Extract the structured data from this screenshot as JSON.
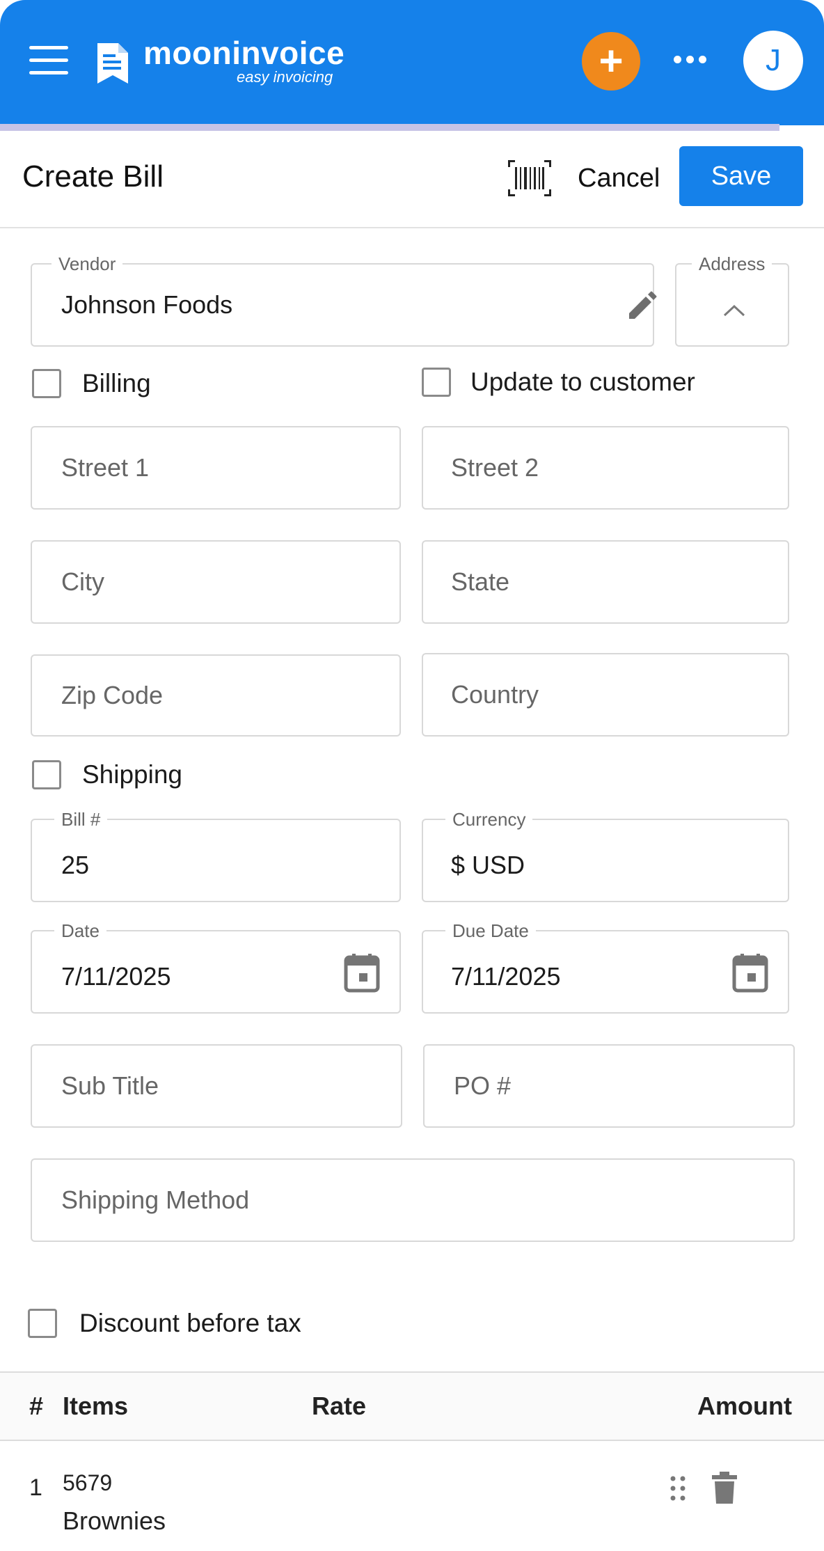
{
  "app": {
    "brand_name": "mooninvoice",
    "brand_tagline": "easy invoicing",
    "add_label": "+",
    "avatar_initial": "J",
    "colors": {
      "primary": "#1581ea",
      "accent": "#f0891c"
    }
  },
  "header": {
    "title": "Create Bill",
    "cancel_label": "Cancel",
    "save_label": "Save"
  },
  "form": {
    "vendor": {
      "label": "Vendor",
      "value": "Johnson Foods"
    },
    "address": {
      "label": "Address"
    },
    "billing_label": "Billing",
    "update_customer_label": "Update to customer",
    "street1_placeholder": "Street 1",
    "street2_placeholder": "Street 2",
    "city_placeholder": "City",
    "state_placeholder": "State",
    "zip_placeholder": "Zip Code",
    "country_placeholder": "Country",
    "shipping_label": "Shipping",
    "bill_no": {
      "label": "Bill #",
      "value": "25"
    },
    "currency": {
      "label": "Currency",
      "value": "$ USD"
    },
    "date": {
      "label": "Date",
      "value": "7/11/2025"
    },
    "due_date": {
      "label": "Due Date",
      "value": "7/11/2025"
    },
    "subtitle_placeholder": "Sub Title",
    "po_placeholder": "PO #",
    "shipping_method_placeholder": "Shipping Method",
    "discount_before_tax_label": "Discount before tax"
  },
  "items_table": {
    "columns": {
      "num": "#",
      "items": "Items",
      "rate": "Rate",
      "amount": "Amount"
    },
    "rows": [
      {
        "num": "1",
        "code": "5679",
        "name": "Brownies"
      }
    ]
  }
}
